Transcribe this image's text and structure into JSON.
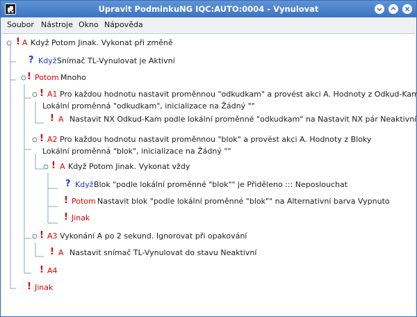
{
  "window": {
    "title": "Upravit PodminkuNG IQC:AUTO:0004 - Vynulovat"
  },
  "menu": [
    "Soubor",
    "Nástroje",
    "Okno",
    "Nápověda"
  ],
  "tree": [
    {
      "mark": "!",
      "key": "A",
      "text": "Když Potom Jinak. Vykonat při změně",
      "keyColor": "red"
    },
    {
      "mark": "?",
      "key": "Když",
      "text": "Snímač TL-Vynulovat je Aktivní",
      "keyColor": "blue"
    },
    {
      "mark": "!",
      "key": "Potom",
      "text": "Mnoho",
      "keyColor": "red"
    },
    {
      "mark": "!",
      "key": "A1",
      "text": "Pro každou hodnotu nastavit proměnnou \"odkudkam\" a provést akci A. Hodnoty z Odkud-Kam",
      "keyColor": "red"
    },
    {
      "mark": "",
      "key": "",
      "text": "Lokální proměnná \"odkudkam\", inicializace na Žádný \"\"",
      "keyColor": ""
    },
    {
      "mark": "!",
      "key": "A",
      "text": "Nastavit NX Odkud-Kam podle lokální proměnné \"odkudkam\" na Nastavit NX pár Neaktivní",
      "keyColor": "red"
    },
    {
      "mark": "!",
      "key": "A2",
      "text": "Pro každou hodnotu nastavit proměnnou \"blok\" a provést akci A. Hodnoty z Bloky",
      "keyColor": "red"
    },
    {
      "mark": "",
      "key": "",
      "text": "Lokální proměnná \"blok\", inicializace na Žádný \"\"",
      "keyColor": ""
    },
    {
      "mark": "!",
      "key": "A",
      "text": "Když Potom Jinak. Vykonat vždy",
      "keyColor": "red"
    },
    {
      "mark": "?",
      "key": "Když",
      "text": "Blok \"podle lokální proměnné \"blok\"\" je Přiděleno ::: Neposlouchat",
      "keyColor": "blue"
    },
    {
      "mark": "!",
      "key": "Potom",
      "text": "Nastavit blok \"podle lokální proměnné \"blok\"\" na Alternativní barva Vypnuto",
      "keyColor": "red"
    },
    {
      "mark": "!",
      "key": "Jinak",
      "text": "",
      "keyColor": "red"
    },
    {
      "mark": "!",
      "key": "A3",
      "text": "Vykonání A po 2 sekund. Ignorovat při opakování",
      "keyColor": "red"
    },
    {
      "mark": "!",
      "key": "A",
      "text": "Nastavit snímač TL-Vynulovat do stavu Neaktivní",
      "keyColor": "red"
    },
    {
      "mark": "!",
      "key": "A4",
      "text": "",
      "keyColor": "red"
    },
    {
      "mark": "!",
      "key": "Jinak",
      "text": "",
      "keyColor": "red"
    }
  ],
  "colors": {
    "red": "#d90000",
    "blue": "#1c3bd6",
    "titlebar": "#4a82cc"
  }
}
